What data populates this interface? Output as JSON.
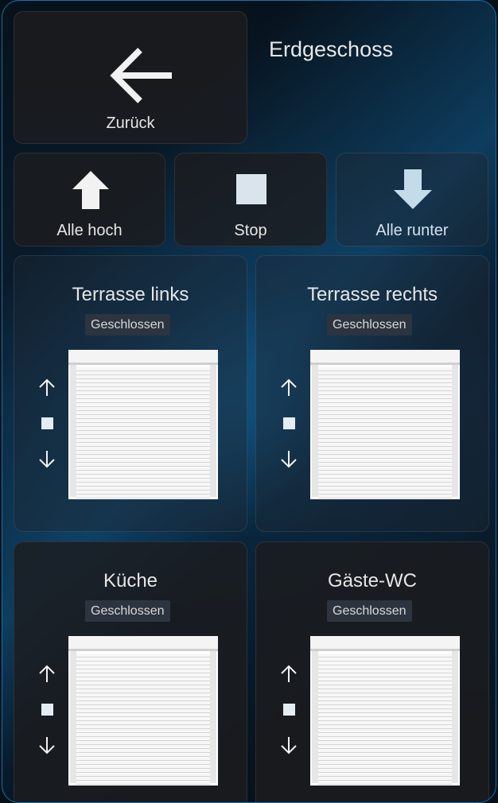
{
  "header": {
    "back_label": "Zurück",
    "title": "Erdgeschoss"
  },
  "actions": {
    "up_label": "Alle hoch",
    "stop_label": "Stop",
    "down_label": "Alle runter"
  },
  "rooms": [
    {
      "name": "Terrasse links",
      "state": "Geschlossen"
    },
    {
      "name": "Terrasse rechts",
      "state": "Geschlossen"
    },
    {
      "name": "Küche",
      "state": "Geschlossen"
    },
    {
      "name": "Gäste-WC",
      "state": "Geschlossen"
    }
  ],
  "colors": {
    "accent": "#1b6fa8",
    "card": "#1c1c1e",
    "icon": "#f2f2f2"
  }
}
